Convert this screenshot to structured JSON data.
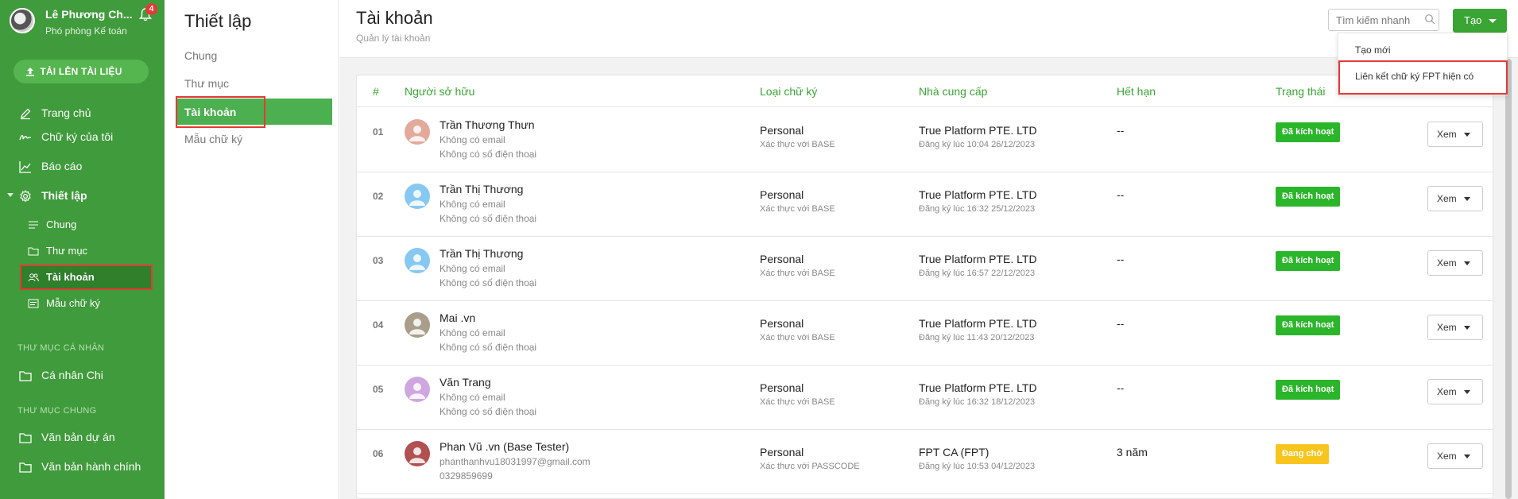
{
  "user": {
    "name": "Lê Phương Ch...",
    "role": "Phó phòng Kế toán",
    "notifications": "4"
  },
  "sidebar": {
    "upload_label": "TẢI LÊN TÀI LIỆU",
    "items": [
      {
        "label": "Trang chủ",
        "icon": "edit-icon"
      },
      {
        "label": "Chữ ký của tôi",
        "icon": "signature-icon"
      },
      {
        "label": "Báo cáo",
        "icon": "chart-icon"
      },
      {
        "label": "Thiết lập",
        "icon": "gear-icon"
      }
    ],
    "subitems": [
      {
        "label": "Chung",
        "icon": "lines-icon"
      },
      {
        "label": "Thư mục",
        "icon": "folder-icon"
      },
      {
        "label": "Tài khoản",
        "icon": "users-icon"
      },
      {
        "label": "Mẫu chữ ký",
        "icon": "template-icon"
      }
    ],
    "personal_section": "THƯ MỤC CÁ NHÂN",
    "personal_items": [
      {
        "label": "Cá nhân Chi"
      }
    ],
    "shared_section": "THƯ MỤC CHUNG",
    "shared_items": [
      {
        "label": "Văn bản dự án"
      },
      {
        "label": "Văn bản hành chính"
      }
    ]
  },
  "settings": {
    "title": "Thiết lập",
    "items": [
      "Chung",
      "Thư mục",
      "Tài khoản",
      "Mẫu chữ ký"
    ]
  },
  "header": {
    "title": "Tài khoản",
    "subtitle": "Quản lý tài khoản",
    "search_placeholder": "Tìm kiếm nhanh",
    "create_label": "Tạo"
  },
  "dropdown": {
    "items": [
      "Tạo mới",
      "Liên kết chữ ký FPT hiện có"
    ]
  },
  "table": {
    "columns": [
      "#",
      "Người sở hữu",
      "Loại chữ ký",
      "Nhà cung cấp",
      "Hết hạn",
      "Trạng thái"
    ],
    "view_label": "Xem",
    "rows": [
      {
        "num": "01",
        "owner": "Trần Thương Thưn",
        "sub1": "Không có email",
        "sub2": "Không có số điện thoại",
        "type": "Personal",
        "type_sub": "Xác thực với BASE",
        "provider": "True Platform PTE. LTD",
        "provider_sub": "Đăng ký lúc 10:04 26/12/2023",
        "expires": "--",
        "status": "Đã kích hoạt",
        "status_color": "#2bb52b",
        "avatar_color": "#e3a99a"
      },
      {
        "num": "02",
        "owner": "Trần Thị Thương",
        "sub1": "Không có email",
        "sub2": "Không có số điện thoại",
        "type": "Personal",
        "type_sub": "Xác thực với BASE",
        "provider": "True Platform PTE. LTD",
        "provider_sub": "Đăng ký lúc 16:32 25/12/2023",
        "expires": "--",
        "status": "Đã kích hoạt",
        "status_color": "#2bb52b",
        "avatar_color": "#86c8f2"
      },
      {
        "num": "03",
        "owner": "Trần Thị Thương",
        "sub1": "Không có email",
        "sub2": "Không có số điện thoại",
        "type": "Personal",
        "type_sub": "Xác thực với BASE",
        "provider": "True Platform PTE. LTD",
        "provider_sub": "Đăng ký lúc 16:57 22/12/2023",
        "expires": "--",
        "status": "Đã kích hoạt",
        "status_color": "#2bb52b",
        "avatar_color": "#86c8f2"
      },
      {
        "num": "04",
        "owner": "Mai .vn",
        "sub1": "Không có email",
        "sub2": "Không có số điện thoại",
        "type": "Personal",
        "type_sub": "Xác thực với BASE",
        "provider": "True Platform PTE. LTD",
        "provider_sub": "Đăng ký lúc 11:43 20/12/2023",
        "expires": "--",
        "status": "Đã kích hoạt",
        "status_color": "#2bb52b",
        "avatar_color": "#a99e8a"
      },
      {
        "num": "05",
        "owner": "Văn Trang",
        "sub1": "Không có email",
        "sub2": "Không có số điện thoại",
        "type": "Personal",
        "type_sub": "Xác thực với BASE",
        "provider": "True Platform PTE. LTD",
        "provider_sub": "Đăng ký lúc 16:32 18/12/2023",
        "expires": "--",
        "status": "Đã kích hoạt",
        "status_color": "#2bb52b",
        "avatar_color": "#cfa6df"
      },
      {
        "num": "06",
        "owner": "Phan Vũ .vn (Base Tester)",
        "sub1": "phanthanhvu18031997@gmail.com",
        "sub2": "0329859699",
        "type": "Personal",
        "type_sub": "Xác thực với PASSCODE",
        "provider": "FPT CA (FPT)",
        "provider_sub": "Đăng ký lúc 10:53 04/12/2023",
        "expires": "3 năm",
        "status": "Đang chờ",
        "status_color": "#f7c51e",
        "avatar_color": "#b05050"
      }
    ]
  }
}
